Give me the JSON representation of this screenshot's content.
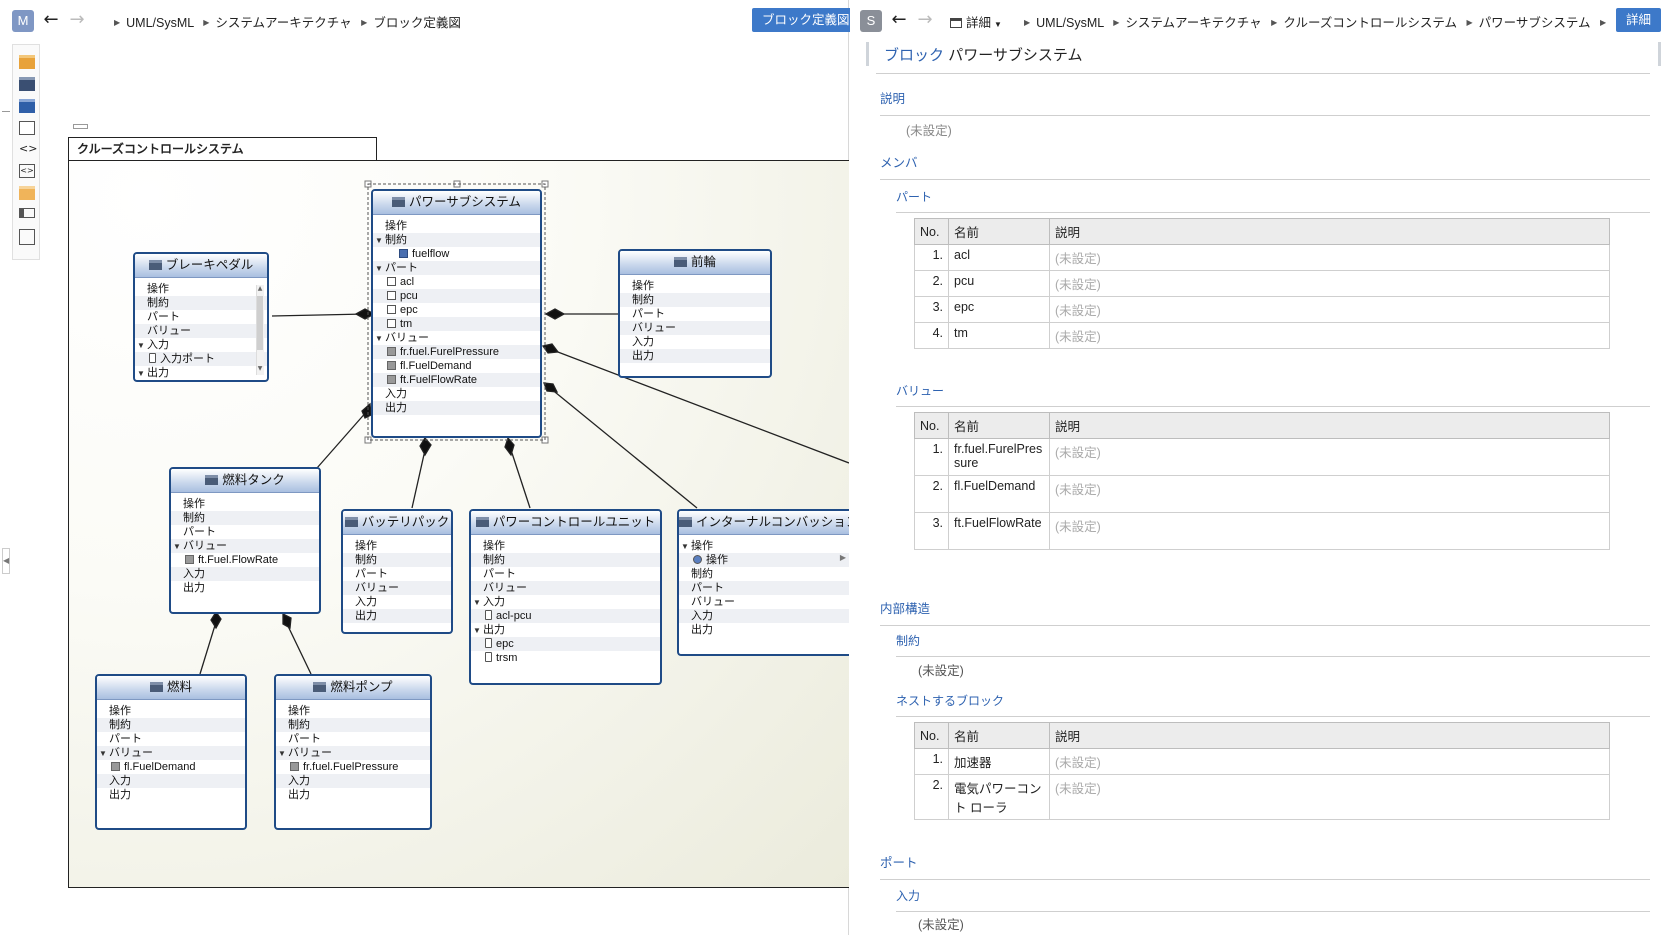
{
  "left_panel": {
    "badge": "M",
    "badge_color": "#7f97c4",
    "breadcrumb": [
      "UML/SysML",
      "システムアーキテクチャ",
      "ブロック定義図"
    ],
    "action_button": "ブロック定義図",
    "frame_title": "クルーズコントロールシステム",
    "blocks": {
      "power": {
        "title": "パワーサブシステム",
        "rows": [
          {
            "text": "操作",
            "indent": 1
          },
          {
            "text": "制約",
            "tri": true
          },
          {
            "text": "fuelflow",
            "icon": "con",
            "indent": 2
          },
          {
            "text": "パート",
            "tri": true
          },
          {
            "text": "acl",
            "icon": "part",
            "indent": 1
          },
          {
            "text": "pcu",
            "icon": "part",
            "indent": 1
          },
          {
            "text": "epc",
            "icon": "part",
            "indent": 1
          },
          {
            "text": "tm",
            "icon": "part",
            "indent": 1
          },
          {
            "text": "バリュー",
            "tri": true
          },
          {
            "text": "fr.fuel.FurelPressure",
            "icon": "val",
            "indent": 1
          },
          {
            "text": "fl.FuelDemand",
            "icon": "val",
            "indent": 1
          },
          {
            "text": "ft.FuelFlowRate",
            "icon": "val",
            "indent": 1
          },
          {
            "text": "入力",
            "indent": 1
          },
          {
            "text": "出力",
            "indent": 1
          }
        ]
      },
      "brake": {
        "title": "ブレーキペダル",
        "rows": [
          {
            "text": "操作",
            "indent": 1
          },
          {
            "text": "制約",
            "indent": 1
          },
          {
            "text": "パート",
            "indent": 1
          },
          {
            "text": "バリュー",
            "indent": 1
          },
          {
            "text": "入力",
            "tri": true
          },
          {
            "text": "入力ポート",
            "icon": "port",
            "indent": 1
          },
          {
            "text": "出力",
            "tri": true
          }
        ]
      },
      "front": {
        "title": "前輪",
        "rows": [
          {
            "text": "操作",
            "indent": 1
          },
          {
            "text": "制約",
            "indent": 1
          },
          {
            "text": "パート",
            "indent": 1
          },
          {
            "text": "バリュー",
            "indent": 1
          },
          {
            "text": "入力",
            "indent": 1
          },
          {
            "text": "出力",
            "indent": 1
          }
        ]
      },
      "tank": {
        "title": "燃料タンク",
        "rows": [
          {
            "text": "操作",
            "indent": 1
          },
          {
            "text": "制約",
            "indent": 1
          },
          {
            "text": "パート",
            "indent": 1
          },
          {
            "text": "バリュー",
            "tri": true
          },
          {
            "text": "ft.Fuel.FlowRate",
            "icon": "val",
            "indent": 1
          },
          {
            "text": "入力",
            "indent": 1
          },
          {
            "text": "出力",
            "indent": 1
          }
        ]
      },
      "battery": {
        "title": "バッテリパック",
        "rows": [
          {
            "text": "操作",
            "indent": 1
          },
          {
            "text": "制約",
            "indent": 1
          },
          {
            "text": "パート",
            "indent": 1
          },
          {
            "text": "バリュー",
            "indent": 1
          },
          {
            "text": "入力",
            "indent": 1
          },
          {
            "text": "出力",
            "indent": 1
          }
        ]
      },
      "pcu": {
        "title": "パワーコントロールユニット",
        "rows": [
          {
            "text": "操作",
            "indent": 1
          },
          {
            "text": "制約",
            "indent": 1
          },
          {
            "text": "パート",
            "indent": 1
          },
          {
            "text": "バリュー",
            "indent": 1
          },
          {
            "text": "入力",
            "tri": true
          },
          {
            "text": "acl-pcu",
            "icon": "port",
            "indent": 1
          },
          {
            "text": "出力",
            "tri": true
          },
          {
            "text": "epc",
            "icon": "port",
            "indent": 1
          },
          {
            "text": "trsm",
            "icon": "port",
            "indent": 1
          }
        ]
      },
      "ice": {
        "title": "インターナルコンバッション",
        "rows": [
          {
            "text": "操作",
            "tri": true
          },
          {
            "text": "操作",
            "icon": "op",
            "indent": 1
          },
          {
            "text": "制約",
            "indent": 1
          },
          {
            "text": "パート",
            "indent": 1
          },
          {
            "text": "バリュー",
            "indent": 1
          },
          {
            "text": "入力",
            "indent": 1
          },
          {
            "text": "出力",
            "indent": 1
          }
        ]
      },
      "fuel": {
        "title": "燃料",
        "rows": [
          {
            "text": "操作",
            "indent": 1
          },
          {
            "text": "制約",
            "indent": 1
          },
          {
            "text": "パート",
            "indent": 1
          },
          {
            "text": "バリュー",
            "tri": true
          },
          {
            "text": "fl.FuelDemand",
            "icon": "val",
            "indent": 1
          },
          {
            "text": "入力",
            "indent": 1
          },
          {
            "text": "出力",
            "indent": 1
          }
        ]
      },
      "pump": {
        "title": "燃料ポンプ",
        "rows": [
          {
            "text": "操作",
            "indent": 1
          },
          {
            "text": "制約",
            "indent": 1
          },
          {
            "text": "パート",
            "indent": 1
          },
          {
            "text": "バリュー",
            "tri": true
          },
          {
            "text": "fr.fuel.FuelPressure",
            "icon": "val",
            "indent": 1
          },
          {
            "text": "入力",
            "indent": 1
          },
          {
            "text": "出力",
            "indent": 1
          }
        ]
      }
    }
  },
  "right_panel": {
    "badge": "S",
    "badge_color": "#8a8f98",
    "view_menu": "詳細",
    "breadcrumb": [
      "UML/SysML",
      "システムアーキテクチャ",
      "クルーズコントロールシステム",
      "パワーサブシステム"
    ],
    "action_button": "詳細",
    "kind": "ブロック",
    "name": "パワーサブシステム",
    "sections": {
      "description": {
        "title": "説明",
        "value": "(未設定)"
      },
      "members": {
        "title": "メンバ"
      },
      "parts": {
        "title": "パート"
      },
      "values": {
        "title": "バリュー"
      },
      "internal": {
        "title": "内部構造"
      },
      "constraints": {
        "title": "制約",
        "value": "(未設定)"
      },
      "nested": {
        "title": "ネストするブロック"
      },
      "ports": {
        "title": "ポート"
      },
      "input": {
        "title": "入力",
        "value": "(未設定)"
      }
    },
    "table_headers": {
      "no": "No.",
      "name": "名前",
      "desc": "説明"
    },
    "parts_table": [
      {
        "no": "1.",
        "name": "acl",
        "desc": "(未設定)"
      },
      {
        "no": "2.",
        "name": "pcu",
        "desc": "(未設定)"
      },
      {
        "no": "3.",
        "name": "epc",
        "desc": "(未設定)"
      },
      {
        "no": "4.",
        "name": "tm",
        "desc": "(未設定)"
      }
    ],
    "values_table": [
      {
        "no": "1.",
        "name": "fr.fuel.FurelPres sure",
        "desc": "(未設定)"
      },
      {
        "no": "2.",
        "name": "fl.FuelDemand",
        "desc": "(未設定)"
      },
      {
        "no": "3.",
        "name": "ft.FuelFlowRate",
        "desc": "(未設定)"
      }
    ],
    "nested_table": [
      {
        "no": "1.",
        "name": "加速器",
        "desc": "(未設定)"
      },
      {
        "no": "2.",
        "name": "電気パワーコント ローラ",
        "desc": "(未設定)"
      }
    ]
  }
}
